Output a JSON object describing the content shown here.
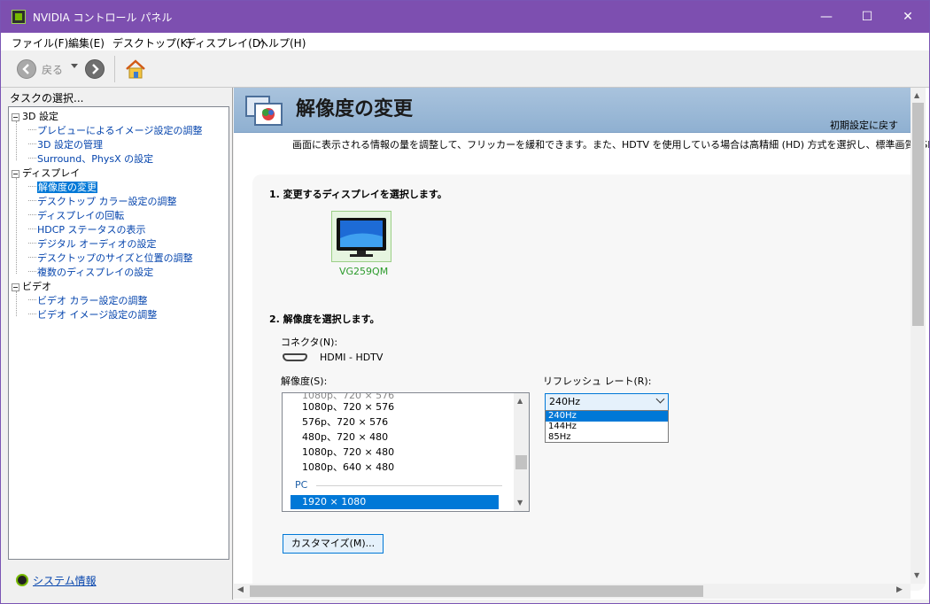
{
  "window": {
    "title": "NVIDIA コントロール パネル",
    "minimize": "—",
    "maximize": "☐",
    "close": "✕"
  },
  "menu": [
    "ファイル(F)",
    "編集(E)",
    "デスクトップ(K)",
    "ディスプレイ(D)",
    "ヘルプ(H)"
  ],
  "toolbar": {
    "back_label": "戻る"
  },
  "left": {
    "task_label": "タスクの選択...",
    "groups": [
      {
        "label": "3D 設定",
        "items": [
          "プレビューによるイメージ設定の調整",
          "3D 設定の管理",
          "Surround、PhysX の設定"
        ]
      },
      {
        "label": "ディスプレイ",
        "items": [
          "解像度の変更",
          "デスクトップ カラー設定の調整",
          "ディスプレイの回転",
          "HDCP ステータスの表示",
          "デジタル オーディオの設定",
          "デスクトップのサイズと位置の調整",
          "複数のディスプレイの設定"
        ]
      },
      {
        "label": "ビデオ",
        "items": [
          "ビデオ カラー設定の調整",
          "ビデオ イメージ設定の調整"
        ]
      }
    ],
    "selected_item": "解像度の変更",
    "system_info": "システム情報"
  },
  "main": {
    "title": "解像度の変更",
    "reset": "初期設定に戻す",
    "description": "画面に表示される情報の量を調整して、フリッカーを緩和できます。また、HDTV を使用している場合は高精細 (HD) 方式を選択し、標準画質 (SD)",
    "step1": "1. 変更するディスプレイを選択します。",
    "monitor_name": "VG259QM",
    "step2": "2. 解像度を選択します。",
    "connector_label": "コネクタ(N):",
    "connector_value": "HDMI - HDTV",
    "resolution_label": "解像度(S):",
    "resolutions": [
      "1080p、720 × 576",
      "576p、720 × 576",
      "480p、720 × 480",
      "1080p、720 × 480",
      "1080p、640 × 480"
    ],
    "res_group": "PC",
    "selected_resolution": "1920 × 1080",
    "refresh_label": "リフレッシュ レート(R):",
    "refresh_value": "240Hz",
    "refresh_options": [
      "240Hz",
      "144Hz",
      "85Hz"
    ],
    "customize": "カスタマイズ(M)..."
  }
}
